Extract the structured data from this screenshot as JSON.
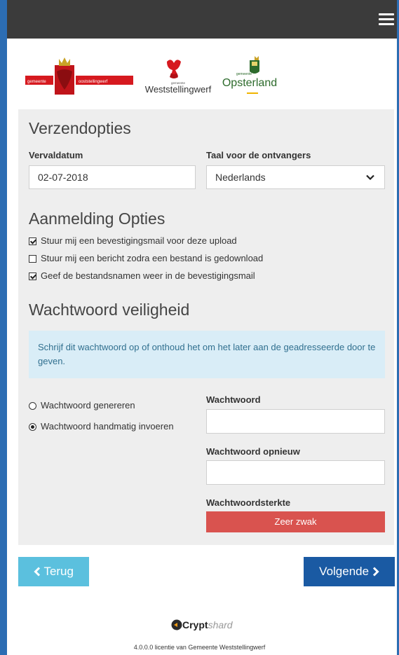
{
  "header": {
    "menu_icon": "hamburger-icon"
  },
  "logos": {
    "logo1_text_left": "gemeente",
    "logo1_text_right": "ooststellingwerf",
    "logo2_small": "gemeente",
    "logo2_name": "Weststellingwerf",
    "logo3_small": "gemeente",
    "logo3_name": "Opsterland"
  },
  "verzend": {
    "title": "Verzendopties",
    "date_label": "Vervaldatum",
    "date_value": "02-07-2018",
    "lang_label": "Taal voor de ontvangers",
    "lang_value": "Nederlands"
  },
  "aanmelding": {
    "title": "Aanmelding Opties",
    "options": [
      {
        "label": "Stuur mij een bevestigingsmail voor deze upload",
        "checked": true
      },
      {
        "label": "Stuur mij een bericht zodra een bestand is gedownload",
        "checked": false
      },
      {
        "label": "Geef de bestandsnamen weer in de bevestigingsmail",
        "checked": true
      }
    ]
  },
  "wachtwoord": {
    "title": "Wachtwoord veiligheid",
    "info": "Schrijf dit wachtwoord op of onthoud het om het later aan de geadresseerde door te geven.",
    "radio_generate": "Wachtwoord genereren",
    "radio_manual": "Wachtwoord handmatig invoeren",
    "selected": "manual",
    "pw_label": "Wachtwoord",
    "pw_value": "",
    "pw2_label": "Wachtwoord opnieuw",
    "pw2_value": "",
    "strength_label": "Wachtwoordsterkte",
    "strength_value": "Zeer zwak",
    "strength_color": "#d9534f"
  },
  "nav": {
    "back_label": "Terug",
    "next_label": "Volgende"
  },
  "footer": {
    "brand_bold": "Crypt",
    "brand_italic": "shard",
    "license": "4.0.0.0 licentie van Gemeente Weststellingwerf"
  },
  "colors": {
    "topbar": "#3b3b3b",
    "accent_blue": "#2c6db3",
    "info_bg": "#d9edf7",
    "back_button": "#5bc0de",
    "next_button": "#1a5aa3"
  }
}
